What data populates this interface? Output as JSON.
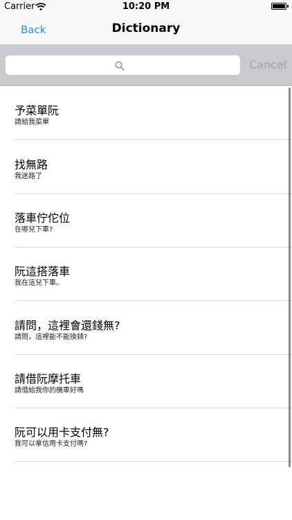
{
  "status_bar": {
    "carrier": "Carrier",
    "time": "10:20 PM"
  },
  "nav": {
    "back_label": "Back",
    "title": "Dictionary"
  },
  "search": {
    "placeholder": "",
    "value": "",
    "cancel_label": "Cancel"
  },
  "colors": {
    "accent": "#2d8fe8",
    "search_bar_bg": "#c9c9ce",
    "cancel_disabled": "#9ea4b2"
  },
  "entries": [
    {
      "title": "予菜單阮",
      "subtitle": "請給我菜單"
    },
    {
      "title": "找無路",
      "subtitle": "我迷路了"
    },
    {
      "title": "落車佇佗位",
      "subtitle": "在哪兒下車?"
    },
    {
      "title": "阮這搭落車",
      "subtitle": "我在這兒下車。"
    },
    {
      "title": "請問，這裡會還錢無?",
      "subtitle": "請問，這裡能不能換錢?"
    },
    {
      "title": "請借阮摩托車",
      "subtitle": "請借給我你的機車好嗎"
    },
    {
      "title": "阮可以用卡支付無?",
      "subtitle": "我可以拿信用卡支付嗎?"
    }
  ]
}
